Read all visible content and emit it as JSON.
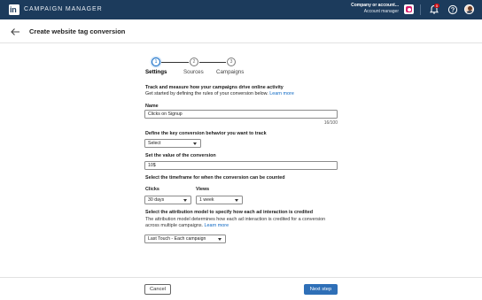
{
  "topbar": {
    "logo_text": "in",
    "app_name": "CAMPAIGN MANAGER",
    "account_line1": "Company or account...",
    "account_line2": "Account manager",
    "notification_count": "5",
    "icons": [
      "linkedin-logo",
      "account-badge-icon",
      "bell-icon",
      "help-icon",
      "avatar"
    ]
  },
  "header": {
    "back_icon": "arrow-left-icon",
    "title": "Create website tag conversion"
  },
  "stepper": {
    "steps": [
      {
        "number": "1",
        "label": "Settings"
      },
      {
        "number": "2",
        "label": "Sources"
      },
      {
        "number": "3",
        "label": "Campaigns"
      }
    ],
    "active_step": 1
  },
  "form": {
    "intro_heading": "Track and measure how your campaigns drive online activity",
    "intro_sub": "Get started by defining the rules of your conversion below.",
    "intro_link": "Learn more",
    "name_label": "Name",
    "name_value": "Clicks on Signup",
    "name_counter": "16/100",
    "behavior_label": "Define the key conversion behavior you want to track",
    "behavior_value": "Select",
    "value_label": "Set the value of the conversion",
    "value_value": "10$",
    "timeframe_label": "Select the timeframe for when the conversion can be counted",
    "clicks_label": "Clicks",
    "clicks_value": "30 days",
    "views_label": "Views",
    "views_value": "1 week",
    "attribution_label": "Select the attribution model to specify how each ad interaction is credited",
    "attribution_desc1": "The attribution model determines how each ad interaction is credited for a conversion",
    "attribution_desc2": "across multiple campaigns.",
    "attribution_link": "Learn more",
    "attribution_value": "Last Touch - Each campaign"
  },
  "footer": {
    "cancel_label": "Cancel",
    "next_label": "Next step"
  },
  "colors": {
    "topbar": "#1c3b5c",
    "accent": "#0a66c2",
    "primary_button": "#2e6fb7"
  }
}
